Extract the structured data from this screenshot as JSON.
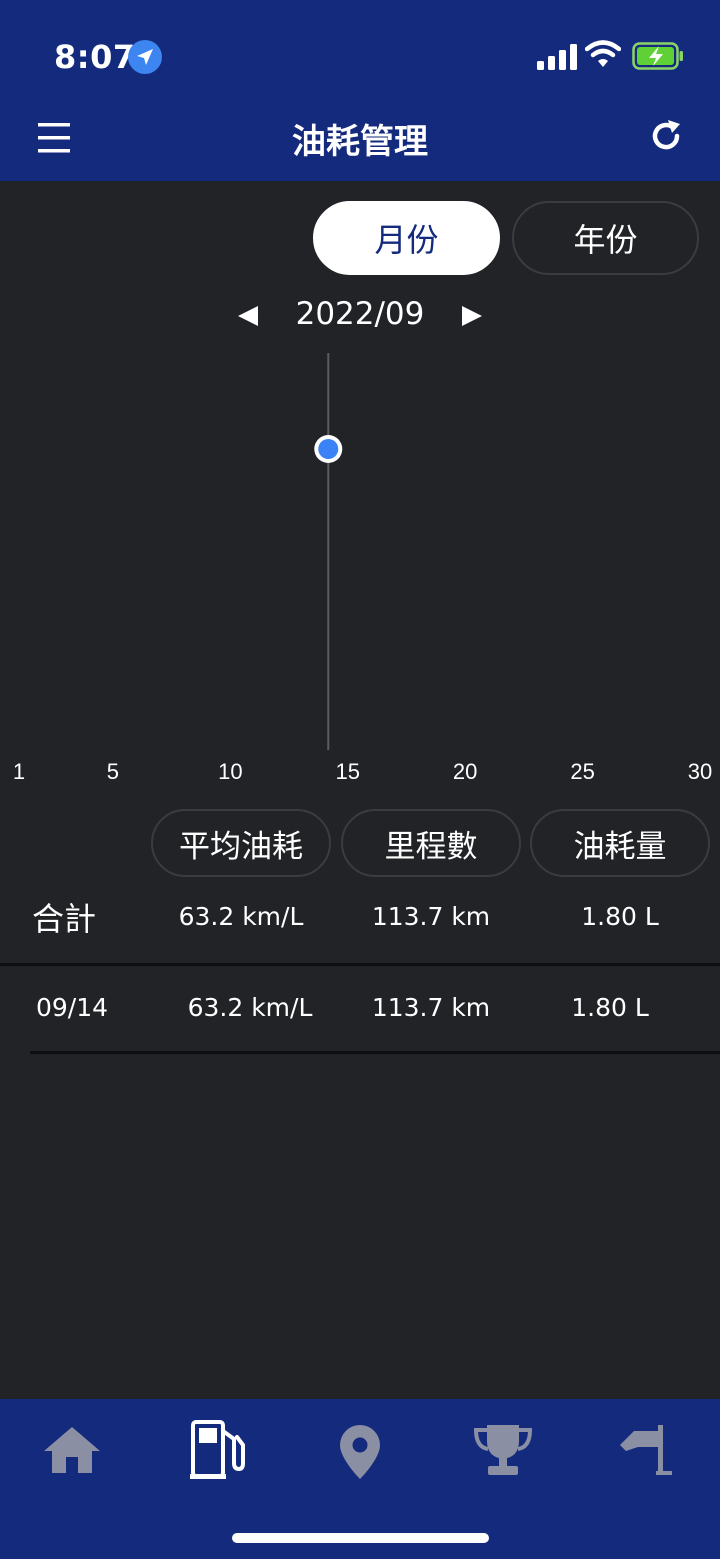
{
  "status": {
    "time": "8:07"
  },
  "header": {
    "title": "油耗管理"
  },
  "period_toggle": {
    "month_label": "月份",
    "year_label": "年份",
    "selected": "月份"
  },
  "month_nav": {
    "label": "2022/09"
  },
  "chart_data": {
    "type": "scatter",
    "x_ticks": [
      "1",
      "5",
      "10",
      "15",
      "20",
      "25",
      "30"
    ],
    "xlim": [
      1,
      30
    ],
    "points": [
      {
        "x": 14,
        "y": 63.2
      }
    ],
    "selected_x": 14,
    "grid": false,
    "point_color": "#3b82f6"
  },
  "metrics": {
    "avg_label": "平均油耗",
    "distance_label": "里程數",
    "fuel_label": "油耗量"
  },
  "total": {
    "label": "合計",
    "avg": "63.2 km/L",
    "distance": "113.7 km",
    "fuel": "1.80 L"
  },
  "entries": [
    {
      "date": "09/14",
      "avg": "63.2 km/L",
      "distance": "113.7 km",
      "fuel": "1.80 L"
    }
  ],
  "nav_tabs": [
    "home-icon",
    "fuel-pump-icon",
    "map-pin-icon",
    "trophy-icon",
    "flag-icon"
  ],
  "colors": {
    "header_bg": "#142a7c",
    "page_bg": "#222327",
    "accent": "#3b82f6",
    "inactive_icon": "#8a8fa3"
  }
}
